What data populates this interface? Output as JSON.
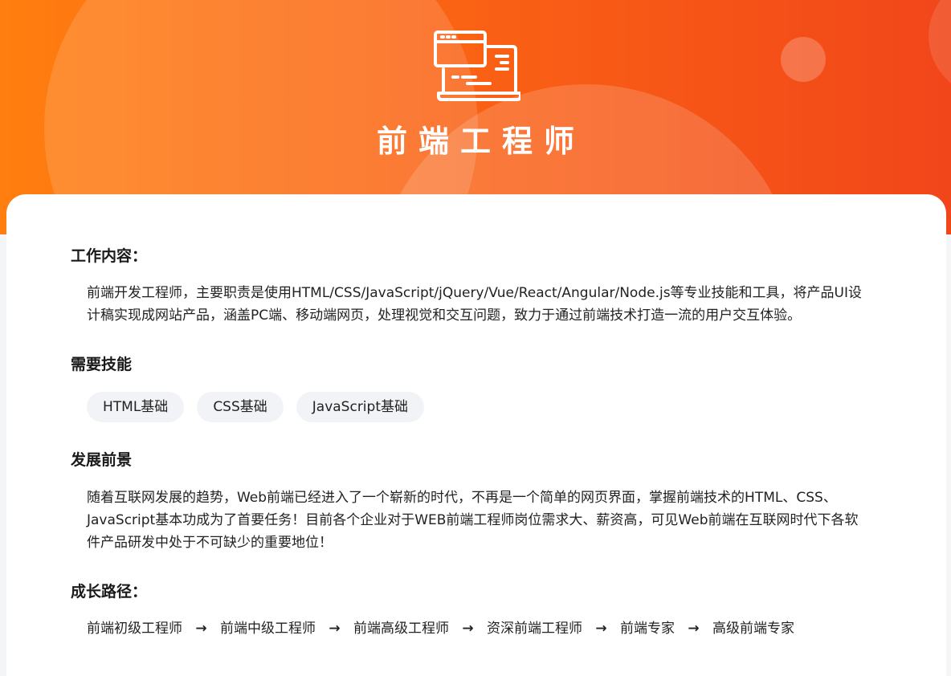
{
  "hero": {
    "icon": "code-window-icon",
    "title": "前端工程师",
    "gradient_colors": [
      "#ff7e0f",
      "#f1461a"
    ]
  },
  "sections": {
    "work": {
      "heading": "工作内容：",
      "text_line1": "前端开发工程师，主要职责是使用HTML/CSS/JavaScript/jQuery/Vue/React/Angular/Node.js等专业技能和工具，将产品UI设",
      "text_line2": "计稿实现成网站产品，涵盖PC端、移动端网页，处理视觉和交互问题，致力于通过前端技术打造一流的用户交互体验。"
    },
    "skills": {
      "heading": "需要技能",
      "tags": [
        "HTML基础",
        "CSS基础",
        "JavaScript基础"
      ]
    },
    "prospect": {
      "heading": "发展前景",
      "text_line1": "随着互联网发展的趋势，Web前端已经进入了一个崭新的时代，不再是一个简单的网页界面，掌握前端技术的HTML、CSS、",
      "text_line2": "JavaScript基本功成为了首要任务！目前各个企业对于WEB前端工程师岗位需求大、薪资高，可见Web前端在互联网时代下各软",
      "text_line3": "件产品研发中处于不可缺少的重要地位！"
    },
    "growth": {
      "heading": "成长路径：",
      "steps": [
        "前端初级工程师",
        "前端中级工程师",
        "前端高级工程师",
        "资深前端工程师",
        "前端专家",
        "高级前端专家"
      ],
      "arrow_icon": "arrow-right-icon"
    }
  }
}
